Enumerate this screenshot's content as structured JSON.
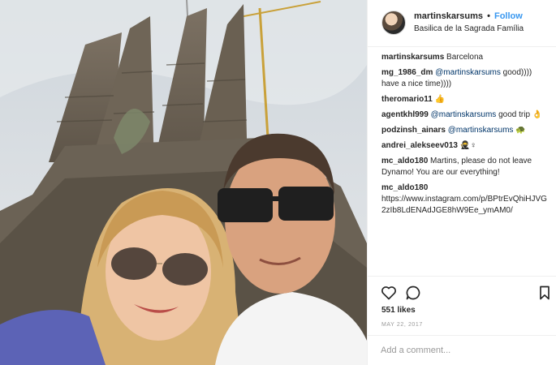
{
  "post": {
    "username": "martinskarsums",
    "separator": "•",
    "follow_label": "Follow",
    "location": "Basilica de la Sagrada Família"
  },
  "comments": [
    {
      "author": "martinskarsums",
      "text": "Barcelona",
      "mention": "",
      "emoji": ""
    },
    {
      "author": "mg_1986_dm",
      "mention": "@martinskarsums",
      "text": "good)))) have a nice time))))",
      "emoji": ""
    },
    {
      "author": "theromario11",
      "mention": "",
      "text": "",
      "emoji": "👍"
    },
    {
      "author": "agentkhl999",
      "mention": "@martinskarsums",
      "text": "good trip",
      "emoji": "👌"
    },
    {
      "author": "podzinsh_ainars",
      "mention": "@martinskarsums",
      "text": "",
      "emoji": "🐢"
    },
    {
      "author": "andrei_alekseev013",
      "mention": "",
      "text": "",
      "emoji": "🥷♀"
    },
    {
      "author": "mc_aldo180",
      "mention": "",
      "text": "Martins, please do not leave Dynamo! You are our everything!",
      "emoji": ""
    },
    {
      "author": "mc_aldo180",
      "mention": "",
      "text": "https://www.instagram.com/p/BPtrEvQhiHJVG2zIb8LdENAdJGE8hW9Ee_ymAM0/",
      "emoji": ""
    }
  ],
  "icons": {
    "like": "heart-icon",
    "comment": "comment-icon",
    "save": "bookmark-icon"
  },
  "likes": "551 likes",
  "date": "MAY 22, 2017",
  "add_comment_placeholder": "Add a comment..."
}
